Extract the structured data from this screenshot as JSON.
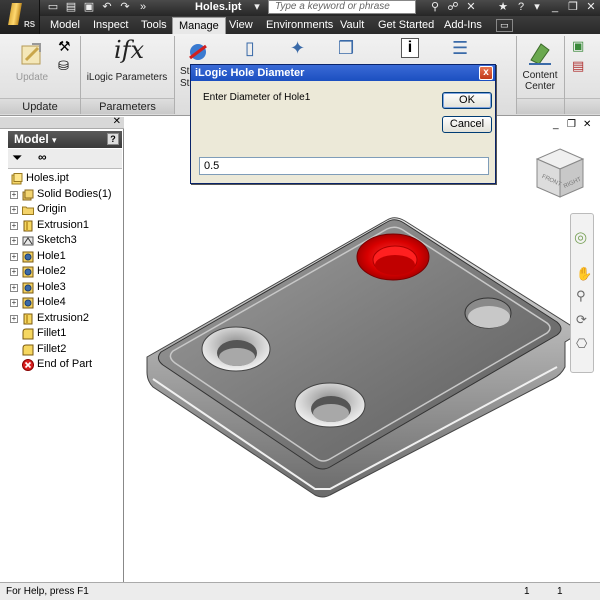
{
  "app": {
    "logo_sub": "RS",
    "document_title": "Holes.ipt",
    "search_placeholder": "Type a keyword or phrase"
  },
  "tabs": [
    {
      "label": "Model"
    },
    {
      "label": "Inspect"
    },
    {
      "label": "Tools"
    },
    {
      "label": "Manage",
      "active": true
    },
    {
      "label": "View"
    },
    {
      "label": "Environments"
    },
    {
      "label": "Vault"
    },
    {
      "label": "Get Started"
    },
    {
      "label": "Add-Ins"
    }
  ],
  "ribbon": {
    "update_label": "Update",
    "ilogic_params_label": "iLogic Parameters",
    "content_center_label": "Content Center",
    "panel_update": "Update",
    "panel_parameters": "Parameters",
    "partial_label_1": "St",
    "partial_label_2": "St"
  },
  "browser": {
    "header": "Model",
    "help_glyph": "?",
    "tree": [
      {
        "label": "Holes.ipt",
        "icon": "part-icon",
        "root": true
      },
      {
        "label": "Solid Bodies(1)",
        "icon": "solid-bodies-icon",
        "expandable": true
      },
      {
        "label": "Origin",
        "icon": "folder-icon",
        "expandable": true
      },
      {
        "label": "Extrusion1",
        "icon": "extrusion-icon",
        "expandable": true
      },
      {
        "label": "Sketch3",
        "icon": "sketch-icon",
        "expandable": true
      },
      {
        "label": "Hole1",
        "icon": "hole-icon",
        "expandable": true
      },
      {
        "label": "Hole2",
        "icon": "hole-icon",
        "expandable": true
      },
      {
        "label": "Hole3",
        "icon": "hole-icon",
        "expandable": true
      },
      {
        "label": "Hole4",
        "icon": "hole-icon",
        "expandable": true
      },
      {
        "label": "Extrusion2",
        "icon": "extrusion-icon",
        "expandable": true
      },
      {
        "label": "Fillet1",
        "icon": "fillet-icon"
      },
      {
        "label": "Fillet2",
        "icon": "fillet-icon"
      },
      {
        "label": "End of Part",
        "icon": "end-of-part-icon"
      }
    ]
  },
  "viewcube": {
    "face_front": "FRONT",
    "face_right": "RIGHT"
  },
  "dialog": {
    "title": "iLogic Hole Diameter",
    "close_glyph": "x",
    "prompt": "Enter Diameter of Hole1",
    "ok_label": "OK",
    "cancel_label": "Cancel",
    "input_value": "0.5"
  },
  "statusbar": {
    "help_text": "For Help, press F1",
    "value1": "1",
    "value2": "1"
  },
  "colors": {
    "highlight_hole": "#e01010",
    "title_bar": "#2b2b2b",
    "dialog_title": "#245edb"
  }
}
